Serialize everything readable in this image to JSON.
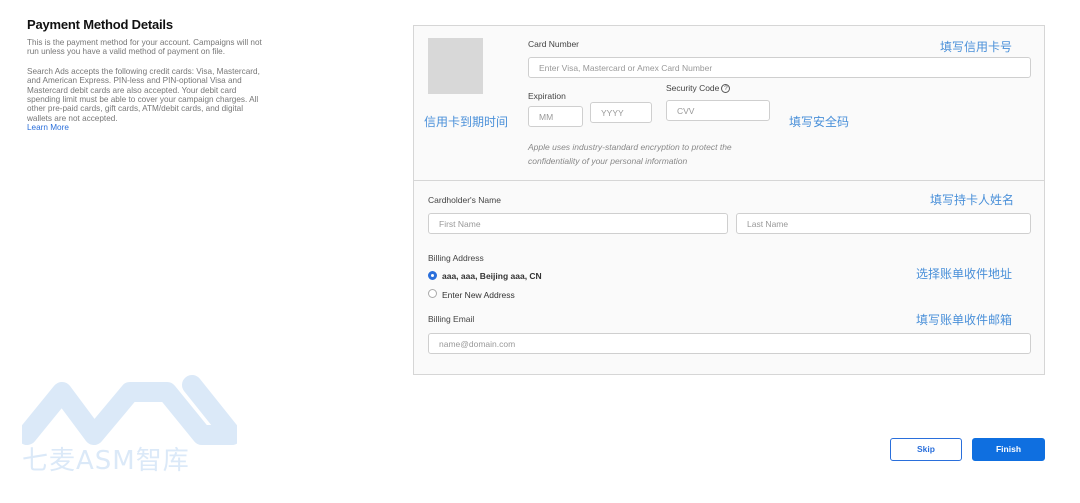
{
  "info": {
    "title": "Payment Method Details",
    "para1": "This is the payment method for your account. Campaigns will not run unless you have a valid method of payment on file.",
    "para2": "Search Ads accepts the following credit cards: Visa, Mastercard, and American Express. PIN-less and PIN-optional Visa and Mastercard debit cards are also accepted. Your debit card spending limit must be able to cover your campaign charges. All other pre-paid cards, gift cards, ATM/debit cards, and digital wallets are not accepted.",
    "learn_more": "Learn More"
  },
  "card": {
    "card_number_label": "Card Number",
    "card_number_placeholder": "Enter Visa, Mastercard or Amex Card Number",
    "expiration_label": "Expiration",
    "month_placeholder": "MM",
    "year_placeholder": "YYYY",
    "security_label": "Security Code",
    "security_help": "?",
    "cvv_placeholder": "CVV",
    "encryption_note_1": "Apple uses industry-standard encryption to protect the",
    "encryption_note_2": "confidentiality of your personal information"
  },
  "billing": {
    "cardholder_label": "Cardholder's Name",
    "first_name_placeholder": "First Name",
    "last_name_placeholder": "Last Name",
    "address_label": "Billing Address",
    "address_option_saved": "aaa, aaa, Beijing aaa, CN",
    "address_option_new": "Enter New Address",
    "email_label": "Billing Email",
    "email_placeholder": "name@domain.com"
  },
  "annotations": {
    "card_number": "填写信用卡号",
    "expiry": "信用卡到期时间",
    "security": "填写安全码",
    "cardholder": "填写持卡人姓名",
    "address": "选择账单收件地址",
    "email": "填写账单收件邮箱"
  },
  "actions": {
    "skip": "Skip",
    "finish": "Finish"
  },
  "watermark": {
    "text": "七麦ASM智库"
  },
  "colors": {
    "accent": "#0f6fe0",
    "annotation": "#4a90d9",
    "watermark": "#dbe9f8"
  }
}
